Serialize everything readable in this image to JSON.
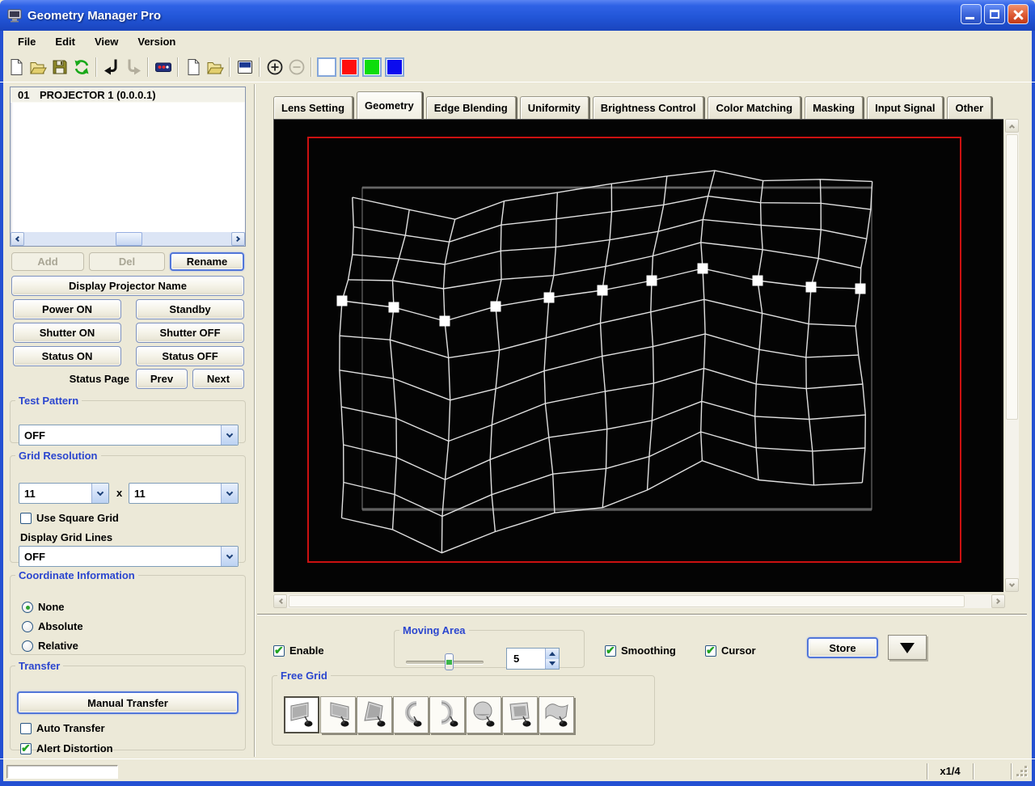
{
  "window": {
    "title": "Geometry Manager Pro"
  },
  "menu": {
    "items": [
      "File",
      "Edit",
      "View",
      "Version"
    ]
  },
  "toolbar": {
    "items": [
      {
        "name": "new-file",
        "icon": "new-file"
      },
      {
        "name": "open-file",
        "icon": "open-file"
      },
      {
        "name": "save-file",
        "icon": "save-file"
      },
      {
        "name": "refresh",
        "icon": "refresh"
      },
      {
        "separator": true
      },
      {
        "name": "assign-left-arrow",
        "icon": "arrow-left"
      },
      {
        "name": "assign-right-arrow",
        "icon": "arrow-right",
        "disabled": true
      },
      {
        "separator": true
      },
      {
        "name": "remote-control",
        "icon": "remote"
      },
      {
        "separator": true
      },
      {
        "name": "new-pattern",
        "icon": "new-file"
      },
      {
        "name": "open-pattern",
        "icon": "open-file"
      },
      {
        "separator": true
      },
      {
        "name": "window-display",
        "icon": "window"
      },
      {
        "separator": true
      },
      {
        "name": "zoom-in",
        "icon": "zoom-in"
      },
      {
        "name": "zoom-out",
        "icon": "zoom-out",
        "disabled": true
      },
      {
        "separator": true
      },
      {
        "name": "color-white",
        "swatch": "#ffffff"
      },
      {
        "name": "color-red",
        "swatch": "#ff0e0e"
      },
      {
        "name": "color-green",
        "swatch": "#0ddd0d"
      },
      {
        "name": "color-blue",
        "swatch": "#0b0bee"
      }
    ]
  },
  "projector_panel": {
    "list": {
      "items": [
        {
          "number": "01",
          "name": "PROJECTOR 1 (0.0.0.1)"
        }
      ]
    },
    "actions": {
      "add": "Add",
      "del": "Del",
      "rename": "Rename"
    },
    "display_projector_name": "Display Projector Name",
    "power": {
      "power_on": "Power ON",
      "standby": "Standby",
      "shutter_on": "Shutter ON",
      "shutter_off": "Shutter OFF",
      "status_on": "Status ON",
      "status_off": "Status OFF"
    },
    "status_page": {
      "label": "Status Page",
      "prev": "Prev",
      "next": "Next"
    },
    "test_pattern": {
      "legend": "Test Pattern",
      "value": "OFF"
    },
    "grid_resolution": {
      "legend": "Grid Resolution",
      "horizontal": "11",
      "separator": "x",
      "vertical": "11",
      "use_square_grid_label": "Use Square Grid",
      "use_square_grid_checked": false,
      "display_grid_lines_label": "Display Grid Lines",
      "display_grid_lines_value": "OFF"
    },
    "coordinate_information": {
      "legend": "Coordinate Information",
      "options": [
        {
          "label": "None",
          "selected": true
        },
        {
          "label": "Absolute",
          "selected": false
        },
        {
          "label": "Relative",
          "selected": false
        }
      ]
    },
    "transfer": {
      "legend": "Transfer",
      "manual_transfer": "Manual Transfer",
      "auto_transfer_label": "Auto Transfer",
      "auto_transfer_checked": false,
      "alert_distortion_label": "Alert Distortion",
      "alert_distortion_checked": true
    }
  },
  "tabs": {
    "items": [
      "Lens Setting",
      "Geometry",
      "Edge Blending",
      "Uniformity",
      "Brightness Control",
      "Color Matching",
      "Masking",
      "Input Signal",
      "Other"
    ],
    "active": "Geometry"
  },
  "canvas": {
    "colors": {
      "background": "#040404",
      "outline": "#cc1111",
      "grid": "#e0e0e0",
      "handle": "#ffffff",
      "reference": "#7d7d7d"
    },
    "red_rect": [
      42,
      22,
      807,
      525
    ],
    "reference_rect": [
      109,
      84,
      630,
      398
    ],
    "grid": {
      "cols": 11,
      "rows": 11,
      "handle_row": 4,
      "sp_above": 32,
      "sp_below": [
        44,
        46,
        48,
        47,
        45,
        44,
        42,
        40,
        42,
        41,
        40
      ],
      "handles": [
        [
          84,
          224
        ],
        [
          148,
          232
        ],
        [
          211,
          249
        ],
        [
          274,
          231
        ],
        [
          340,
          220
        ],
        [
          406,
          211
        ],
        [
          467,
          199
        ],
        [
          530,
          184
        ],
        [
          598,
          199
        ],
        [
          664,
          207
        ],
        [
          725,
          209
        ]
      ],
      "handle_size": 13
    }
  },
  "bottom_panel": {
    "enable": {
      "label": "Enable",
      "checked": true
    },
    "moving_area": {
      "legend": "Moving Area",
      "value": "5",
      "slider_pos": 0.55
    },
    "smoothing": {
      "label": "Smoothing",
      "checked": true
    },
    "cursor": {
      "label": "Cursor",
      "checked": true
    },
    "store": {
      "label": "Store"
    },
    "free_grid": {
      "legend": "Free Grid",
      "selected_index": 0,
      "presets": [
        "flat-screen",
        "flat-screen-right",
        "tilted-screen",
        "cylinder-concave",
        "cylinder-convex",
        "dome",
        "angled-screen",
        "wave-screen"
      ]
    }
  },
  "status_bar": {
    "scale": "x1/4"
  }
}
